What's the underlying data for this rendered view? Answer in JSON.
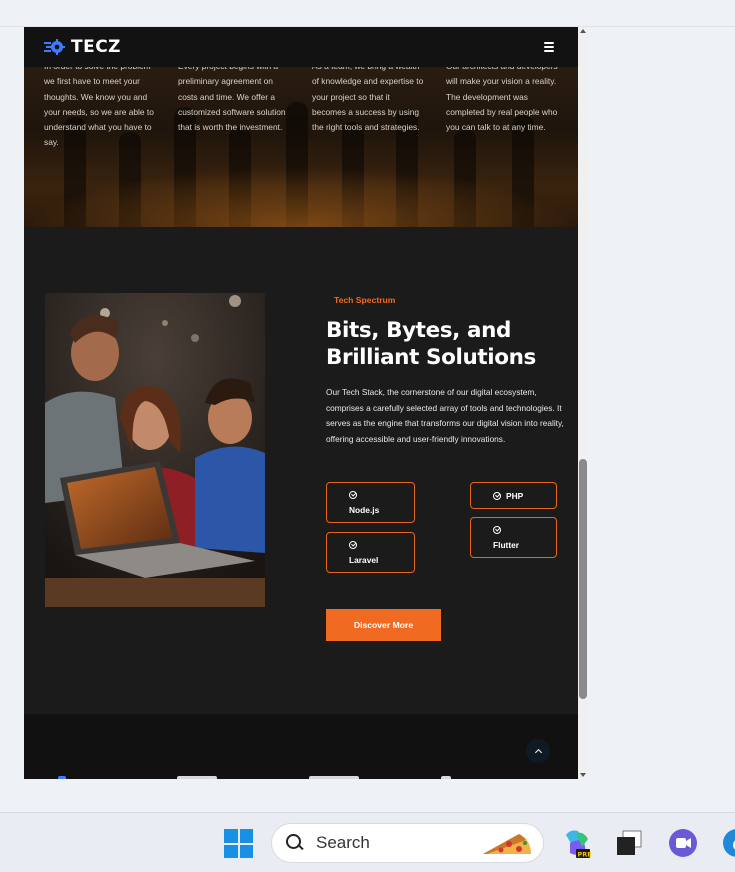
{
  "brand": {
    "name": "TECZ"
  },
  "top_columns": [
    {
      "text": "In order to solve the problem we first have to meet your thoughts. We know you and your needs, so we are able to understand what you have to say."
    },
    {
      "text": "Every project begins with a preliminary agreement on costs and time. We offer a customized software solution that is worth the investment."
    },
    {
      "text": "As a team, we bring a wealth of knowledge and expertise to your project so that it becomes a success by using the right tools and strategies."
    },
    {
      "text": "Our architects and developers will make your vision a reality. The development was completed by real people who you can talk to at any time."
    }
  ],
  "tech_section": {
    "eyebrow": "Tech Spectrum",
    "heading": "Bits, Bytes, and Brilliant Solutions",
    "description": "Our Tech Stack, the cornerstone of our digital ecosystem, comprises a carefully selected array of tools and technologies. It serves as the engine that transforms our digital vision into reality, offering accessible and user-friendly innovations.",
    "technologies": [
      "Node.js",
      "PHP",
      "Laravel",
      "Flutter"
    ],
    "cta_label": "Discover More"
  },
  "taskbar": {
    "search_label": "Search"
  },
  "colors": {
    "accent": "#f06a22",
    "page_background": "#1b1b1c",
    "header_background": "#121212",
    "footer_background": "#111112",
    "taskbar_background": "#e9edf3"
  },
  "icons": {
    "logo": "tecz-logo-icon",
    "menu": "hamburger-menu-icon",
    "check": "check-circle-icon",
    "back_to_top": "chevron-up-icon",
    "start": "windows-start-icon",
    "search": "search-icon",
    "search_highlight": "pizza-icon",
    "copilot": "copilot-icon",
    "task_view": "task-view-icon",
    "teams": "teams-icon",
    "edge": "edge-icon"
  }
}
